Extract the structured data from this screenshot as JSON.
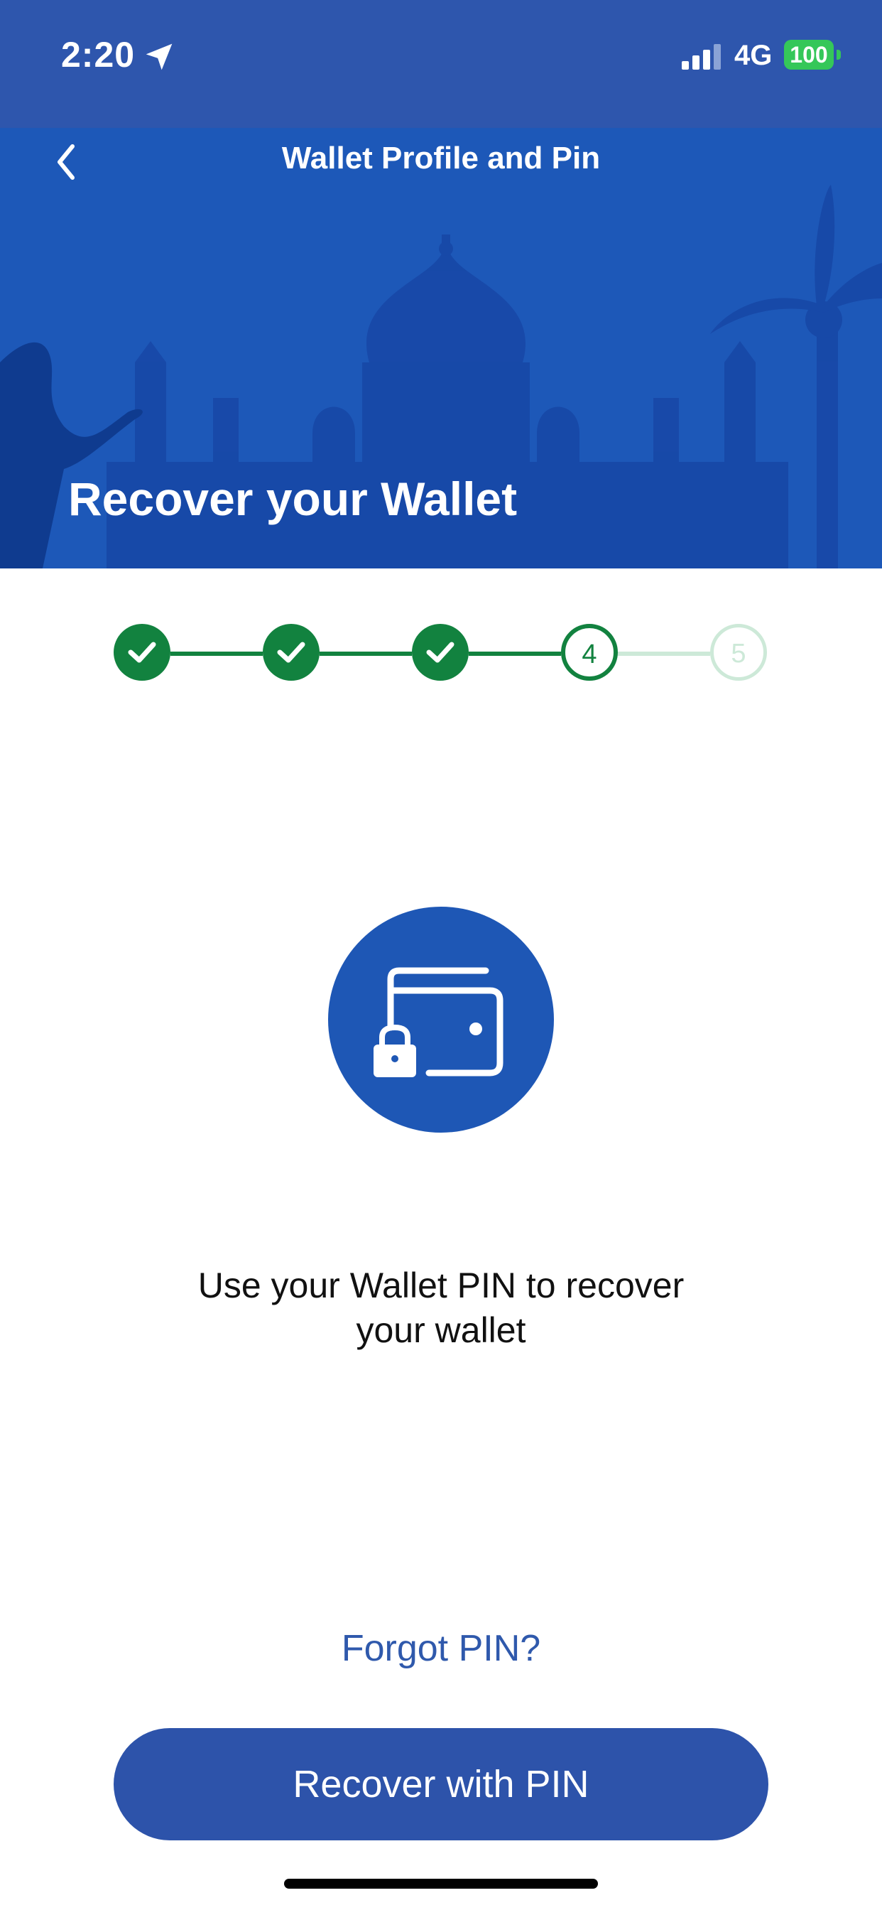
{
  "status_bar": {
    "time": "2:20",
    "network": "4G",
    "battery": "100",
    "signal_icon": "cellular-signal-icon",
    "location_icon": "location-arrow-icon"
  },
  "header": {
    "title": "Wallet Profile and Pin",
    "back_icon": "chevron-left-icon",
    "background_color": "#1d58b8"
  },
  "hero": {
    "title": "Recover your Wallet"
  },
  "stepper": {
    "steps": [
      {
        "state": "completed",
        "label": ""
      },
      {
        "state": "completed",
        "label": ""
      },
      {
        "state": "completed",
        "label": ""
      },
      {
        "state": "current",
        "label": "4"
      },
      {
        "state": "pending",
        "label": "5"
      }
    ],
    "active_color": "#12823f",
    "pending_color": "#cde9d8"
  },
  "main": {
    "icon": "wallet-lock-icon",
    "message": "Use your Wallet PIN to recover your wallet",
    "forgot_link": "Forgot PIN?",
    "primary_button": "Recover with PIN",
    "accent_color": "#2d53aa"
  }
}
